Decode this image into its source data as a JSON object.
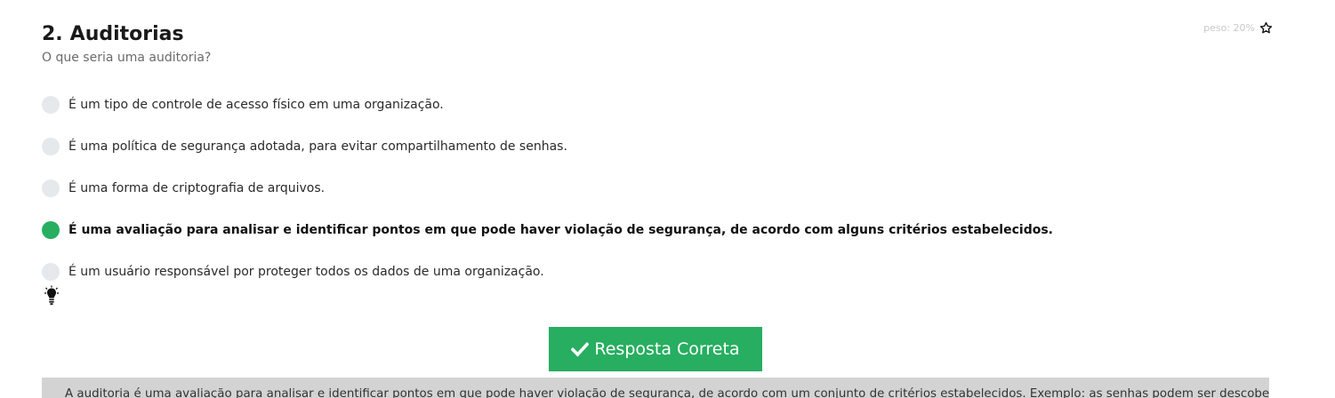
{
  "question": {
    "number": "2.",
    "title": "Auditorias",
    "subtitle": "O que seria uma auditoria?",
    "weight_label": "peso: 20%",
    "weight_icon": "star-outline-icon"
  },
  "options": [
    {
      "label": "É um tipo de controle de acesso físico em uma organização.",
      "selected": false
    },
    {
      "label": "É uma política de segurança adotada, para evitar compartilhamento de senhas.",
      "selected": false
    },
    {
      "label": "É uma forma de criptografia de arquivos.",
      "selected": false
    },
    {
      "label": "É uma avaliação para analisar e identificar pontos em que pode haver violação de segurança, de acordo com alguns critérios estabelecidos.",
      "selected": true
    },
    {
      "label": "É um usuário responsável por proteger todos os dados de uma organização.",
      "selected": false
    }
  ],
  "hint": {
    "icon": "lightbulb-icon"
  },
  "result": {
    "button_label": "Resposta Correta",
    "icon": "check-icon",
    "color": "#27ae60"
  },
  "explanation": {
    "text": "A auditoria é uma avaliação para analisar e identificar pontos em que pode haver violação de segurança, de acordo com um conjunto de critérios estabelecidos. Exemplo: as senhas podem ser descobertas"
  },
  "colors": {
    "accent": "#27ae60",
    "radio_unselected": "#e6e9ec",
    "explanation_bg": "#d3d3d3"
  }
}
